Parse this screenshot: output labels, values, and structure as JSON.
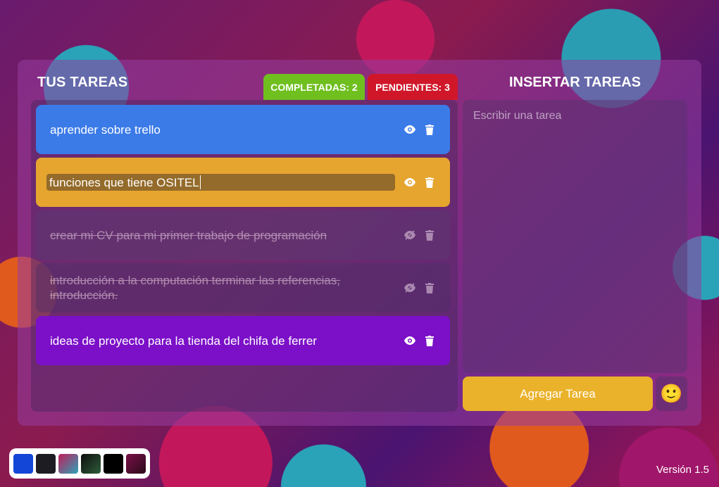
{
  "left_panel": {
    "title": "TUS TAREAS",
    "completed_label": "COMPLETADAS: 2",
    "pending_label": "PENDIENTES: 3"
  },
  "tasks": [
    {
      "text": "aprender sobre trello",
      "color": "#3b7be8",
      "done": false,
      "view_icon": "eye-icon",
      "delete_icon": "trash-icon"
    },
    {
      "text": "funciones que tiene OSITEL",
      "color": "#e6a52e",
      "done": false,
      "editing": true,
      "view_icon": "eye-icon",
      "delete_icon": "trash-icon"
    },
    {
      "text": "crear mi CV para mi primer trabajo de programación",
      "color": "#5a3a72",
      "done": true,
      "view_icon": "eye-off-icon",
      "delete_icon": "trash-icon"
    },
    {
      "text": "introducción a la computación terminar las referencias, introducción.",
      "color": "#4e2e68",
      "done": true,
      "view_icon": "eye-off-icon",
      "delete_icon": "trash-icon"
    },
    {
      "text": "ideas de proyecto para la tienda del chifa de ferrer",
      "color": "#7b10c8",
      "done": false,
      "view_icon": "eye-icon",
      "delete_icon": "trash-icon"
    }
  ],
  "right_panel": {
    "title": "INSERTAR TAREAS",
    "textarea_placeholder": "Escribir una tarea",
    "add_button": "Agregar Tarea",
    "emoji_button": "🙂"
  },
  "themes": {
    "swatches": [
      "#1346d6",
      "#1c1c22",
      "#c21d5b",
      "#0d0d0d",
      "#000000",
      "#7b1048"
    ]
  },
  "version": "Versión 1.5"
}
